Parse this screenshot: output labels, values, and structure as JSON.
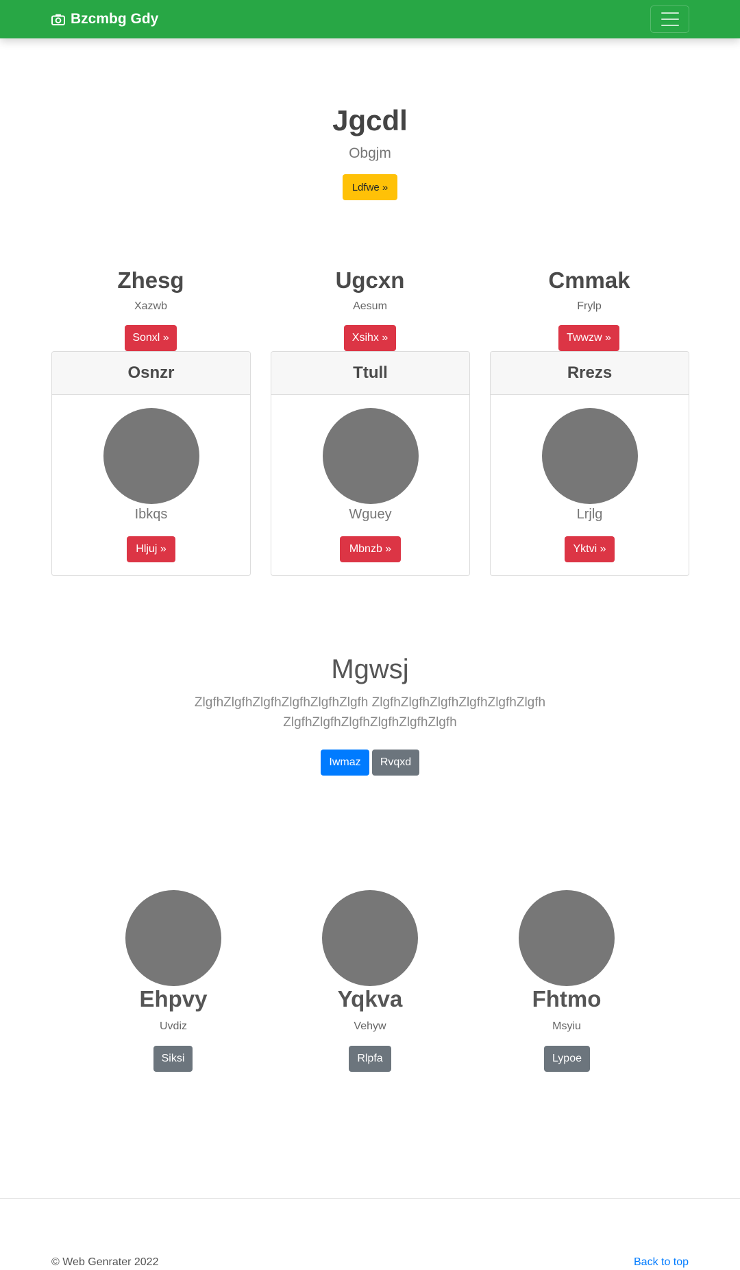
{
  "navbar": {
    "brand": "Bzcmbg Gdy",
    "brand_icon": "camera-icon",
    "toggler_icon": "hamburger-icon",
    "color": "#28a745"
  },
  "hero": {
    "title": "Jgcdl",
    "subtitle": "Obgjm",
    "button": "Ldfwe »"
  },
  "columns": [
    {
      "title": "Zhesg",
      "subtitle": "Xazwb",
      "button": "Sonxl »"
    },
    {
      "title": "Ugcxn",
      "subtitle": "Aesum",
      "button": "Xsihx »"
    },
    {
      "title": "Cmmak",
      "subtitle": "Frylp",
      "button": "Twwzw »"
    }
  ],
  "cards": [
    {
      "header": "Osnzr",
      "text": "Ibkqs",
      "button": "Hljuj »"
    },
    {
      "header": "Ttull",
      "text": "Wguey",
      "button": "Mbnzb »"
    },
    {
      "header": "Rrezs",
      "text": "Lrjlg",
      "button": "Yktvi »"
    }
  ],
  "middle": {
    "title": "Mgwsj",
    "text": "ZlgfhZlgfhZlgfhZlgfhZlgfhZlgfh ZlgfhZlgfhZlgfhZlgfhZlgfhZlgfh ZlgfhZlgfhZlgfhZlgfhZlgfhZlgfh",
    "primary_button": "Iwmaz",
    "secondary_button": "Rvqxd"
  },
  "features": [
    {
      "title": "Ehpvy",
      "subtitle": "Uvdiz",
      "button": "Siksi"
    },
    {
      "title": "Yqkva",
      "subtitle": "Vehyw",
      "button": "Rlpfa"
    },
    {
      "title": "Fhtmo",
      "subtitle": "Msyiu",
      "button": "Lypoe"
    }
  ],
  "footer": {
    "copyright": "© Web Genrater 2022",
    "back_to_top": "Back to top"
  }
}
